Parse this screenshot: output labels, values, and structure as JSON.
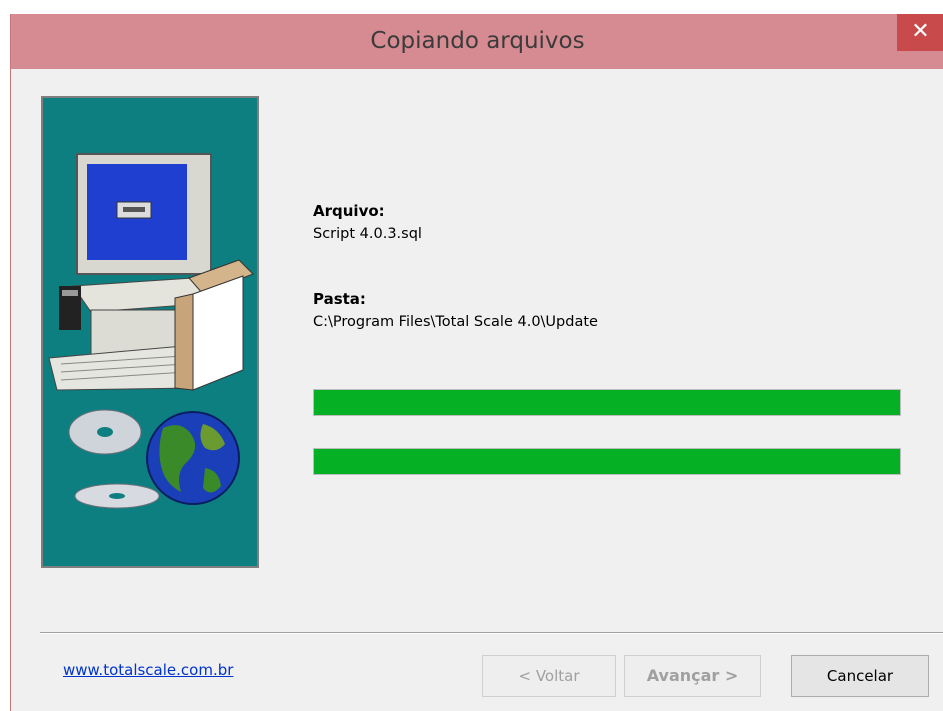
{
  "window": {
    "title": "Copiando arquivos",
    "close_glyph": "✕"
  },
  "file": {
    "label": "Arquivo:",
    "value": "Script 4.0.3.sql"
  },
  "folder": {
    "label": "Pasta:",
    "value": "C:\\Program Files\\Total Scale 4.0\\Update"
  },
  "progress": {
    "file_fraction": 1.0,
    "total_fraction": 1.0,
    "color": "#06b025"
  },
  "footer": {
    "link_text": "www.totalscale.com.br",
    "back_label": "< Voltar",
    "next_label": "Avançar >",
    "cancel_label": "Cancelar"
  },
  "illustration": {
    "icon": "computer-globe-cds-icon",
    "background": "#0e7f80"
  }
}
